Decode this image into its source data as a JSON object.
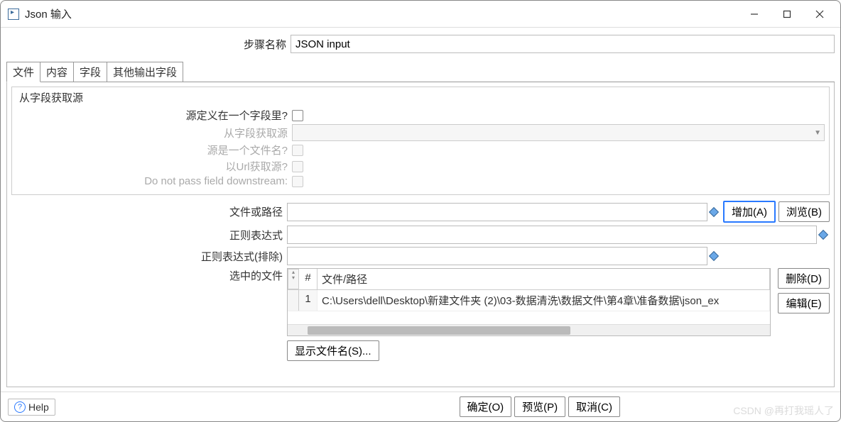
{
  "window": {
    "title": "Json 输入"
  },
  "step": {
    "label": "步骤名称",
    "value": "JSON input"
  },
  "tabs": {
    "file": "文件",
    "content": "内容",
    "fields": "字段",
    "other": "其他输出字段"
  },
  "source_group": {
    "title": "从字段获取源",
    "defined_in_field": "源定义在一个字段里?",
    "from_field": "从字段获取源",
    "is_file": "源是一个文件名?",
    "from_url": "以Url获取源?",
    "no_pass": "Do not pass field downstream:"
  },
  "file_section": {
    "file_or_path": "文件或路径",
    "regex": "正则表达式",
    "regex_exclude": "正则表达式(排除)",
    "selected": "选中的文件",
    "add": "增加(A)",
    "browse": "浏览(B)",
    "delete": "删除(D)",
    "edit": "编辑(E)",
    "show_filename": "显示文件名(S)..."
  },
  "table": {
    "headers": {
      "num": "#",
      "path": "文件/路径"
    },
    "rows": [
      {
        "num": "1",
        "path": "C:\\Users\\dell\\Desktop\\新建文件夹 (2)\\03-数据清洗\\数据文件\\第4章\\准备数据\\json_ex"
      }
    ]
  },
  "footer": {
    "help": "Help",
    "ok": "确定(O)",
    "preview": "预览(P)",
    "cancel": "取消(C)"
  },
  "watermark": "CSDN @再打我瑶人了"
}
